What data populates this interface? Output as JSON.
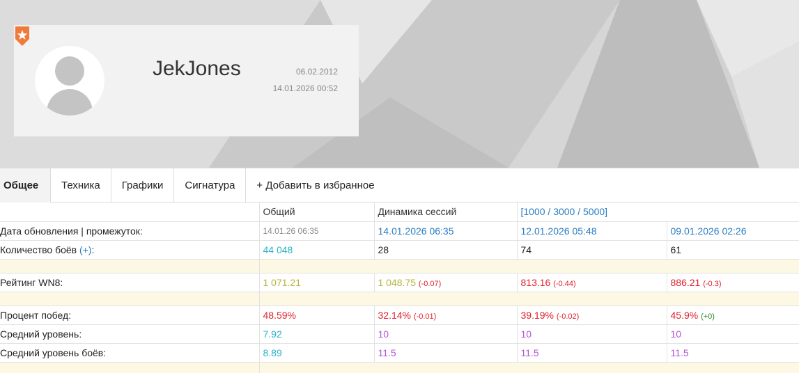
{
  "profile": {
    "username": "JekJones",
    "registered": "06.02.2012",
    "last_battle": "14.01.2026 00:52"
  },
  "tabs": [
    {
      "label": "Общее"
    },
    {
      "label": "Техника"
    },
    {
      "label": "Графики"
    },
    {
      "label": "Сигнатура"
    },
    {
      "label": "+ Добавить в избранное"
    }
  ],
  "table": {
    "headers": {
      "total": "Общий",
      "dynamics": "Динамика сессий",
      "ranges": "[1000 / 3000 / 5000]"
    },
    "update": {
      "label": "Дата обновления | промежуток:",
      "total": "14.01.26 06:35",
      "s1": "14.01.2026 06:35",
      "s2": "12.01.2026 05:48",
      "s3": "09.01.2026 02:26"
    },
    "battles": {
      "label": "Количество боёв",
      "plus": "(+)",
      "colon": ":",
      "total": "44 048",
      "s1": "28",
      "s2": "74",
      "s3": "61"
    },
    "wn8": {
      "label": "Рейтинг WN8:",
      "total": "1 071.21",
      "s1": "1 048.75",
      "s1_delta": "(-0.07)",
      "s2": "813.16",
      "s2_delta": "(-0.44)",
      "s3": "886.21",
      "s3_delta": "(-0.3)"
    },
    "winrate": {
      "label": "Процент побед:",
      "total": "48.59%",
      "s1": "32.14%",
      "s1_delta": "(-0.01)",
      "s2": "39.19%",
      "s2_delta": "(-0.02)",
      "s3": "45.9%",
      "s3_delta": "(+0)"
    },
    "avg_tier": {
      "label": "Средний уровень:",
      "total": "7.92",
      "s1": "10",
      "s2": "10",
      "s3": "10"
    },
    "avg_battle_tier": {
      "label": "Средний уровень боёв:",
      "total": "8.89",
      "s1": "11.5",
      "s2": "11.5",
      "s3": "11.5"
    }
  },
  "colors": {
    "teal": "#2ab4c8",
    "olive": "#b5b53a",
    "red": "#e0202a",
    "purple": "#b455d6",
    "link": "#2a7cc2",
    "badge": "#f07a3c",
    "gap_row": "#fcf8e3"
  }
}
